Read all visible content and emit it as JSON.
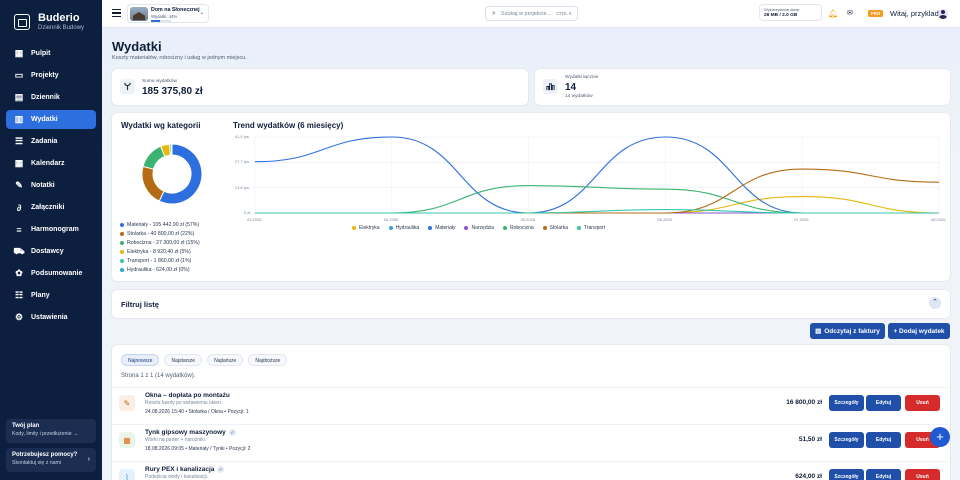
{
  "brand": {
    "name": "Buderio",
    "subtitle": "Dziennik Budowy"
  },
  "nav": [
    {
      "label": "Pulpit",
      "icon": "grid-icon",
      "active": false
    },
    {
      "label": "Projekty",
      "icon": "folder-icon",
      "active": false
    },
    {
      "label": "Dziennik",
      "icon": "journal-icon",
      "active": false
    },
    {
      "label": "Wydatki",
      "icon": "receipt-icon",
      "active": true
    },
    {
      "label": "Zadania",
      "icon": "tasks-icon",
      "active": false
    },
    {
      "label": "Kalendarz",
      "icon": "calendar-icon",
      "active": false
    },
    {
      "label": "Notatki",
      "icon": "pen-icon",
      "active": false
    },
    {
      "label": "Załączniki",
      "icon": "paperclip-icon",
      "active": false
    },
    {
      "label": "Harmonogram",
      "icon": "schedule-icon",
      "active": false
    },
    {
      "label": "Dostawcy",
      "icon": "truck-icon",
      "active": false
    },
    {
      "label": "Podsumowanie",
      "icon": "summary-icon",
      "active": false
    },
    {
      "label": "Plany",
      "icon": "plans-icon",
      "active": false
    },
    {
      "label": "Ustawienia",
      "icon": "gear-icon",
      "active": false
    }
  ],
  "plan": {
    "title": "Twój plan",
    "subtitle": "Kody, limity i przedłużenie →"
  },
  "help": {
    "title": "Potrzebujesz pomocy?",
    "subtitle": "Skontaktuj się z nami"
  },
  "topbar": {
    "project_name": "Dom na Słonecznej",
    "project_sub": "Wydatki: 44%",
    "project_progress": 0.44,
    "search_placeholder": "Szukaj w projekcie...",
    "search_shortcut": "CTRL K",
    "storage_label": "Wykorzystane dane:",
    "storage_value": "26 MB / 2.0 GB",
    "pro_badge": "PRO",
    "greeting": "Witaj, przyklad"
  },
  "page": {
    "title": "Wydatki",
    "subtitle": "Koszty materiałów, robocizny i usług w jednym miejscu."
  },
  "stats": {
    "sum_label": "Suma wydatków",
    "sum_value": "185 375,80 zł",
    "count_label": "Wydatki łącznie",
    "count_value": "14",
    "count_sub": "14 wydatków"
  },
  "category_title": "Wydatki wg kategorii",
  "trend_title": "Trend wydatków (6 miesięcy)",
  "colors": {
    "Materiały": "#2e6fe0",
    "Stolarka": "#b56a14",
    "Robocizna": "#3cb371",
    "Elektryka": "#e5b80b",
    "Transport": "#35c7a8",
    "Hydraulika": "#2fa6d8",
    "Narzędzia": "#8a55d9"
  },
  "chart_data": [
    {
      "type": "pie",
      "title": "Wydatki wg kategorii",
      "categories": [
        "Materiały",
        "Stolarka",
        "Robocizna",
        "Elektryka",
        "Transport",
        "Hydraulika"
      ],
      "values": [
        105442.9,
        40800.0,
        27300.0,
        8920.4,
        1860.0,
        624.0
      ],
      "labels": [
        "Materiały - 105 442,90 zł (57%)",
        "Stolarka - 40 800,00 zł (22%)",
        "Robocizna - 27 300,00 zł (15%)",
        "Elektryka - 8 920,40 zł (5%)",
        "Transport - 1 860,00 zł (1%)",
        "Hydraulika - 624,00 zł (0%)"
      ]
    },
    {
      "type": "line",
      "title": "Trend wydatków (6 miesięcy)",
      "x": [
        "03.2026",
        "04.2026",
        "05.2026",
        "06.2026",
        "07.2026",
        "08.2026"
      ],
      "y_ticks": [
        "0 zł",
        "13,8 tys.",
        "27,7 tys.",
        "41,5 tys."
      ],
      "ylim": [
        0,
        41500
      ],
      "legend_position": "bottom",
      "series": [
        {
          "name": "Elektryka",
          "values": [
            0,
            0,
            0,
            0,
            9000,
            0
          ]
        },
        {
          "name": "Hydraulika",
          "values": [
            0,
            0,
            0,
            0,
            0,
            0
          ]
        },
        {
          "name": "Materiały",
          "values": [
            28000,
            41500,
            0,
            41500,
            0,
            0
          ]
        },
        {
          "name": "Narzędzia",
          "values": [
            0,
            0,
            0,
            0,
            0,
            0
          ]
        },
        {
          "name": "Robocizna",
          "values": [
            0,
            0,
            15000,
            13000,
            0,
            0
          ]
        },
        {
          "name": "Stolarka",
          "values": [
            0,
            0,
            0,
            0,
            24000,
            16800
          ]
        },
        {
          "name": "Transport",
          "values": [
            0,
            0,
            0,
            1860,
            0,
            0
          ]
        }
      ]
    }
  ],
  "filter": {
    "title": "Filtruj listę"
  },
  "actions": {
    "scan_label": "Odczytaj z faktury",
    "add_label": "+ Dodaj wydatek"
  },
  "sort_tabs": [
    "Najnowsze",
    "Najstarsze",
    "Najtańsze",
    "Najdroższe"
  ],
  "page_info": "Strona 1 z 1 (14 wydatków).",
  "row_buttons": {
    "details": "Szczegóły",
    "edit": "Edytuj",
    "delete": "Usuń"
  },
  "expenses": [
    {
      "title": "Okna – dopłata po montażu",
      "desc": "Reszta kwoty po wstawieniu okien.",
      "meta": "24.08.2026 15:40 • Stolarka / Okna • Pozycji: 1",
      "amount": "16 800,00 zł",
      "icon": "brush-icon",
      "verified": false
    },
    {
      "title": "Tynk gipsowy maszynowy",
      "desc": "Worki na parter + narożniki.",
      "meta": "18.08.2026 09:05 • Materiały / Tynki • Pozycji: 2",
      "amount": "51,50 zł",
      "icon": "bricks-icon",
      "verified": true
    },
    {
      "title": "Rury PEX i kanalizacja",
      "desc": "Podejścia wody i kanalizacji.",
      "meta": "",
      "amount": "624,00 zł",
      "icon": "pipe-icon",
      "verified": true
    }
  ]
}
